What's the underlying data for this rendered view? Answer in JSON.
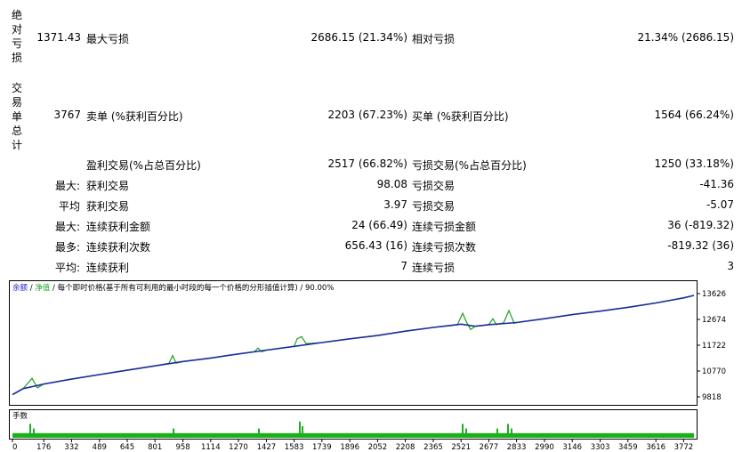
{
  "stats": {
    "abs_dd_group": "绝对亏损",
    "abs_dd_value": "1371.43",
    "max_dd_label": "最大亏损",
    "max_dd_value": "2686.15 (21.34%)",
    "rel_dd_label": "相对亏损",
    "rel_dd_value": "21.34% (2686.15)",
    "trades_group": "交易单总计",
    "trades_total": "3767",
    "short_label": "卖单 (%获利百分比)",
    "short_value": "2203 (67.23%)",
    "long_label": "买单 (%获利百分比)",
    "long_value": "1564 (66.24%)",
    "profit_trades_label": "盈利交易(%占总百分比)",
    "profit_trades_value": "2517 (66.82%)",
    "loss_trades_label": "亏损交易(%占总百分比)",
    "loss_trades_value": "1250 (33.18%)",
    "rows": [
      {
        "prefix": "最大:",
        "l1": "获利交易",
        "v1": "98.08",
        "l2": "亏损交易",
        "v2": "-41.36"
      },
      {
        "prefix": "平均",
        "l1": "获利交易",
        "v1": "3.97",
        "l2": "亏损交易",
        "v2": "-5.07"
      },
      {
        "prefix": "最大:",
        "l1": "连续获利金额",
        "v1": "24 (66.49)",
        "l2": "连续亏损金额",
        "v2": "36 (-819.32)"
      },
      {
        "prefix": "最多:",
        "l1": "连续获利次数",
        "v1": "656.43 (16)",
        "l2": "连续亏损次数",
        "v2": "-819.32 (36)"
      },
      {
        "prefix": "平均:",
        "l1": "连续获利",
        "v1": "7",
        "l2": "连续亏损",
        "v2": "3"
      }
    ]
  },
  "chart_header": {
    "balance": "余额",
    "sep1": " / ",
    "equity": "净值",
    "rest": " / 每个即时价格(基于所有可利用的最小时段的每一个价格的分形插值计算) / 90.00%"
  },
  "volume_label": "手数",
  "colors": {
    "balance": "#1c2d9a",
    "equity": "#1fa01f",
    "volume": "#1cae1c",
    "label_blue": "#2a2acb"
  },
  "chart_data": {
    "type": "line",
    "x_ticks": [
      0,
      176,
      332,
      489,
      645,
      801,
      958,
      1114,
      1270,
      1427,
      1583,
      1739,
      1896,
      2052,
      2208,
      2365,
      2521,
      2677,
      2833,
      2990,
      3146,
      3303,
      3459,
      3616,
      3772
    ],
    "y_ticks": [
      9818,
      10770,
      11722,
      12674,
      13626
    ],
    "xlim": [
      0,
      3830
    ],
    "ylim": [
      9818,
      13626
    ],
    "series": [
      {
        "name": "余额",
        "x": [
          0,
          60,
          176,
          332,
          489,
          645,
          801,
          958,
          1114,
          1270,
          1427,
          1583,
          1739,
          1896,
          2052,
          2208,
          2365,
          2521,
          2600,
          2677,
          2833,
          2990,
          3146,
          3303,
          3459,
          3616,
          3772,
          3830
        ],
        "y": [
          9900,
          10120,
          10290,
          10470,
          10640,
          10800,
          10960,
          11120,
          11250,
          11400,
          11540,
          11680,
          11820,
          11960,
          12080,
          12240,
          12380,
          12500,
          12420,
          12480,
          12560,
          12700,
          12850,
          12980,
          13120,
          13280,
          13470,
          13560
        ]
      },
      {
        "name": "净值",
        "x": [
          0,
          60,
          110,
          140,
          176,
          332,
          489,
          645,
          801,
          880,
          900,
          920,
          958,
          1114,
          1270,
          1360,
          1380,
          1400,
          1427,
          1583,
          1600,
          1625,
          1650,
          1739,
          1896,
          2052,
          2208,
          2365,
          2500,
          2530,
          2550,
          2575,
          2600,
          2677,
          2700,
          2720,
          2740,
          2760,
          2790,
          2820,
          2833,
          2990,
          3146,
          3303,
          3459,
          3616,
          3772,
          3830
        ],
        "y": [
          9900,
          10120,
          10500,
          10150,
          10290,
          10470,
          10640,
          10800,
          10960,
          11060,
          11340,
          11060,
          11120,
          11250,
          11400,
          11480,
          11620,
          11480,
          11540,
          11680,
          11960,
          12040,
          11780,
          11820,
          11960,
          12080,
          12240,
          12380,
          12470,
          12900,
          12600,
          12300,
          12420,
          12480,
          12700,
          12480,
          12520,
          12550,
          13000,
          12530,
          12560,
          12700,
          12850,
          12980,
          13120,
          13280,
          13470,
          13560
        ]
      }
    ],
    "volume": {
      "base": 1,
      "spikes": [
        {
          "x": 100,
          "v": 6
        },
        {
          "x": 120,
          "v": 4
        },
        {
          "x": 905,
          "v": 4
        },
        {
          "x": 1385,
          "v": 4
        },
        {
          "x": 1615,
          "v": 7
        },
        {
          "x": 1630,
          "v": 5
        },
        {
          "x": 2530,
          "v": 6
        },
        {
          "x": 2550,
          "v": 4
        },
        {
          "x": 2725,
          "v": 4
        },
        {
          "x": 2785,
          "v": 6
        },
        {
          "x": 2805,
          "v": 4
        }
      ]
    }
  }
}
